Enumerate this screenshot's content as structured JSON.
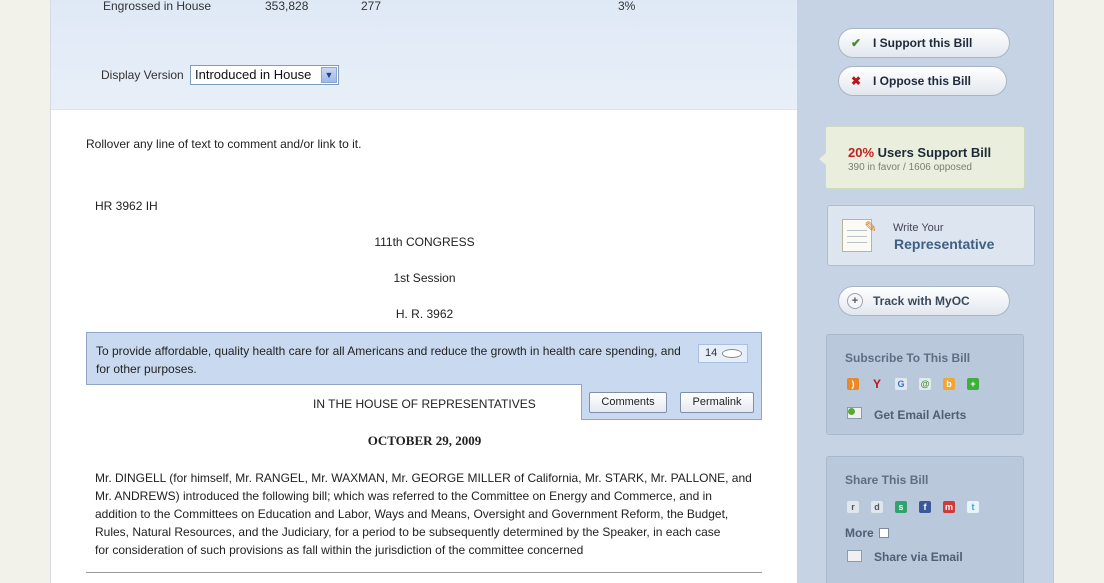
{
  "versions_row": {
    "name": "Engrossed in House",
    "words": "353,828",
    "changes": "277",
    "percent": "3%"
  },
  "display_version": {
    "label": "Display Version",
    "selected": "Introduced in House"
  },
  "instructions": "Rollover any line of text to comment and/or link to it.",
  "bill": {
    "id_line": "HR 3962 IH",
    "congress": "111th CONGRESS",
    "session": "1st Session",
    "number": "H. R. 3962",
    "purpose": "To provide affordable, quality health care for all Americans and reduce the growth in health care spending, and for other purposes.",
    "comment_count": "14",
    "comments_button": "Comments",
    "permalink_button": "Permalink",
    "chamber": "IN THE HOUSE OF REPRESENTATIVES",
    "date": "OCTOBER 29, 2009",
    "intro_lines": [
      "Mr. DINGELL (for himself, Mr. RANGEL, Mr. WAXMAN, Mr. GEORGE MILLER of California, Mr. STARK, Mr. PALLONE, and",
      "Mr. ANDREWS) introduced the following bill; which was referred to the Committee on Energy and Commerce, and in",
      "addition to the Committees on Education and Labor, Ways and Means, Oversight and Government Reform, the Budget,",
      "Rules, Natural Resources, and the Judiciary, for a period to be subsequently determined by the Speaker, in each case",
      "for consideration of such provisions as fall within the jurisdiction of the committee concerned"
    ]
  },
  "sidebar": {
    "support_label": "I Support this Bill",
    "oppose_label": "I Oppose this Bill",
    "support_pct": "20%",
    "support_text": "Users Support Bill",
    "support_detail": "390 in favor / 1606 opposed",
    "write_line1": "Write Your",
    "write_line2": "Representative",
    "track_label": "Track with MyOC",
    "subscribe_title": "Subscribe To This Bill",
    "subscribe_icons": [
      "rss-icon",
      "yahoo-icon",
      "google-icon",
      "newsgator-icon",
      "bloglines-icon",
      "add-feed-icon"
    ],
    "email_alerts": "Get Email Alerts",
    "share_title": "Share This Bill",
    "share_icons": [
      "reddit-icon",
      "delicious-icon",
      "stumbleupon-icon",
      "facebook-icon",
      "myspace-icon",
      "twitter-icon"
    ],
    "more_label": "More",
    "share_email": "Share via Email"
  },
  "colors": {
    "accent_red": "#c21f1f",
    "support_green": "#4a8a28",
    "highlight_blue": "#c9daf0"
  }
}
